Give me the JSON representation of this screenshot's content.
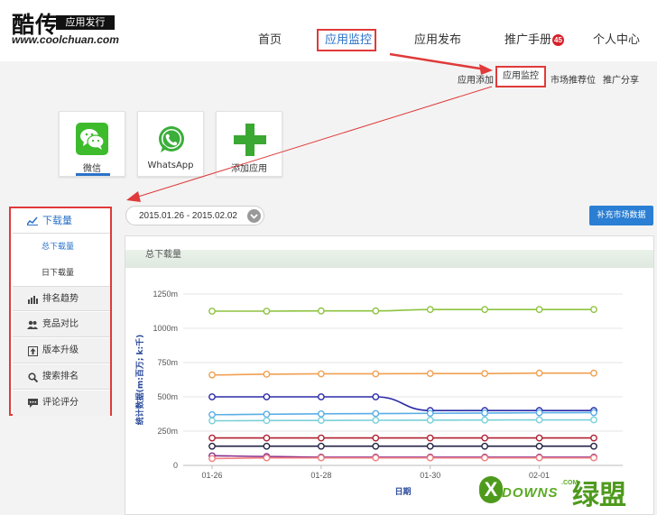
{
  "header": {
    "logo_text": "酷传",
    "logo_tag": "应用发行",
    "logo_url": "www.coolchuan.com",
    "nav": [
      {
        "label": "首页"
      },
      {
        "label": "应用监控"
      },
      {
        "label": "应用发布"
      },
      {
        "label": "推广手册"
      },
      {
        "label": "个人中心"
      }
    ],
    "badge": "45"
  },
  "subnav": {
    "items": [
      "应用添加",
      "应用监控",
      "市场推荐位",
      "推广分享"
    ]
  },
  "apps": [
    {
      "label": "微信",
      "icon": "wechat-icon"
    },
    {
      "label": "WhatsApp",
      "icon": "whatsapp-icon"
    },
    {
      "label": "添加应用",
      "icon": "plus-icon"
    }
  ],
  "sidebar": {
    "download_head": "下载量",
    "total_download": "总下载量",
    "daily_download": "日下载量",
    "items": [
      {
        "label": "排名趋势",
        "icon": "bar-chart-icon"
      },
      {
        "label": "竞品对比",
        "icon": "users-icon"
      },
      {
        "label": "版本升级",
        "icon": "upgrade-icon"
      },
      {
        "label": "搜索排名",
        "icon": "search-icon"
      },
      {
        "label": "评论评分",
        "icon": "comment-icon"
      }
    ]
  },
  "date_range": "2015.01.26 - 2015.02.02",
  "market_button": "补充市场数据",
  "panel_title": "总下载量",
  "chart_data": {
    "type": "line",
    "title": "",
    "xlabel": "日期",
    "ylabel": "统计数据(m:百万; k:千)",
    "y_ticks": [
      "0",
      "250m",
      "500m",
      "750m",
      "1000m",
      "1250m"
    ],
    "ylim": [
      0,
      1250
    ],
    "x_ticks": [
      "01-26",
      "01-28",
      "01-30",
      "02-01"
    ],
    "x": [
      "01-26",
      "01-27",
      "01-28",
      "01-29",
      "01-30",
      "01-31",
      "02-01",
      "02-02"
    ],
    "grid": true,
    "series": [
      {
        "color": "#8dc33f",
        "values": [
          1125,
          1125,
          1127,
          1127,
          1137,
          1137,
          1137,
          1137
        ]
      },
      {
        "color": "#f0a050",
        "values": [
          660,
          665,
          668,
          668,
          670,
          670,
          673,
          673
        ]
      },
      {
        "color": "#2a2aa8",
        "values": [
          500,
          500,
          500,
          500,
          400,
          400,
          400,
          400
        ]
      },
      {
        "color": "#5aaee6",
        "values": [
          370,
          373,
          376,
          378,
          380,
          382,
          384,
          385
        ]
      },
      {
        "color": "#7ad0d8",
        "values": [
          325,
          327,
          328,
          329,
          330,
          331,
          332,
          332
        ]
      },
      {
        "color": "#b02030",
        "values": [
          200,
          200,
          200,
          200,
          200,
          200,
          200,
          200
        ]
      },
      {
        "color": "#222244",
        "values": [
          140,
          140,
          140,
          140,
          140,
          140,
          140,
          140
        ]
      },
      {
        "color": "#8a2a8a",
        "values": [
          70,
          65,
          60,
          60,
          60,
          60,
          60,
          60
        ]
      },
      {
        "color": "#f08080",
        "values": [
          50,
          55,
          55,
          55,
          55,
          55,
          55,
          55
        ]
      }
    ]
  },
  "watermark": {
    "x": "X",
    "text": "DOWNS",
    "com": ".COM",
    "cn": "绿盟"
  }
}
